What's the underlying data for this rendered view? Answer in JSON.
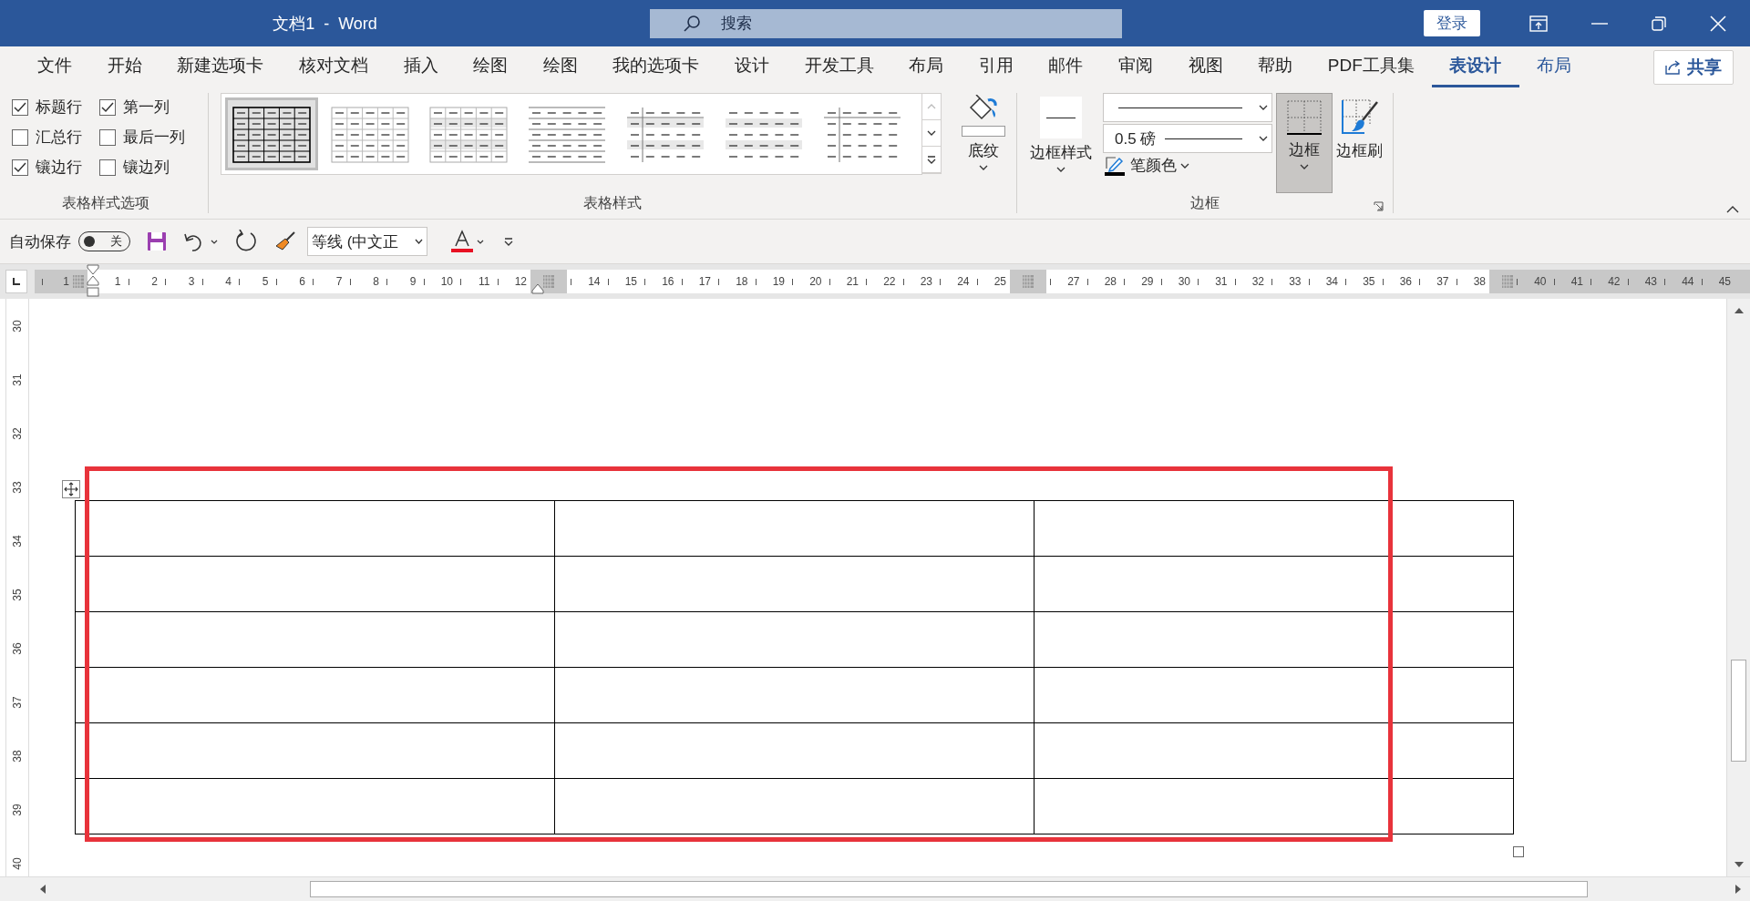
{
  "title_bar": {
    "title": "文档1  -  Word",
    "search": {
      "placeholder": "搜索"
    },
    "sign_in": "登录"
  },
  "menu_tabs": [
    {
      "label": "文件",
      "selected": false,
      "contextual": false
    },
    {
      "label": "开始",
      "selected": false,
      "contextual": false
    },
    {
      "label": "新建选项卡",
      "selected": false,
      "contextual": false
    },
    {
      "label": "核对文档",
      "selected": false,
      "contextual": false
    },
    {
      "label": "插入",
      "selected": false,
      "contextual": false
    },
    {
      "label": "绘图",
      "selected": false,
      "contextual": false
    },
    {
      "label": "绘图",
      "selected": false,
      "contextual": false
    },
    {
      "label": "我的选项卡",
      "selected": false,
      "contextual": false
    },
    {
      "label": "设计",
      "selected": false,
      "contextual": false
    },
    {
      "label": "开发工具",
      "selected": false,
      "contextual": false
    },
    {
      "label": "布局",
      "selected": false,
      "contextual": false
    },
    {
      "label": "引用",
      "selected": false,
      "contextual": false
    },
    {
      "label": "邮件",
      "selected": false,
      "contextual": false
    },
    {
      "label": "审阅",
      "selected": false,
      "contextual": false
    },
    {
      "label": "视图",
      "selected": false,
      "contextual": false
    },
    {
      "label": "帮助",
      "selected": false,
      "contextual": false
    },
    {
      "label": "PDF工具集",
      "selected": false,
      "contextual": false
    },
    {
      "label": "表设计",
      "selected": true,
      "contextual": true
    },
    {
      "label": "布局",
      "selected": false,
      "contextual": true
    }
  ],
  "share": "共享",
  "ribbon": {
    "table_style_options": {
      "options": [
        {
          "label": "标题行",
          "checked": true
        },
        {
          "label": "第一列",
          "checked": true
        },
        {
          "label": "汇总行",
          "checked": false
        },
        {
          "label": "最后一列",
          "checked": false
        },
        {
          "label": "镶边行",
          "checked": true
        },
        {
          "label": "镶边列",
          "checked": false
        }
      ],
      "caption": "表格样式选项"
    },
    "table_styles": {
      "styles": [
        {
          "kind": "grid-bold",
          "selected": true
        },
        {
          "kind": "grid-light",
          "selected": false
        },
        {
          "kind": "grid-shaded",
          "selected": false
        },
        {
          "kind": "lines",
          "selected": false
        },
        {
          "kind": "banded-split",
          "selected": false
        },
        {
          "kind": "banded",
          "selected": false
        },
        {
          "kind": "split",
          "selected": false
        }
      ],
      "caption": "表格样式"
    },
    "shading": {
      "label": "底纹"
    },
    "borders": {
      "border_styles": "边框样式",
      "pen_weight": "0.5 磅",
      "pen_color": "笔颜色",
      "borders_button": {
        "label": "边框",
        "selected": true
      },
      "border_painter": "边框刷",
      "caption": "边框"
    }
  },
  "quick_access": {
    "autosave": {
      "label": "自动保存",
      "on": false,
      "state_text": "关"
    },
    "font": "等线 (中文正"
  },
  "ruler": {
    "segments": [
      {
        "kind": "margin",
        "labels": [
          "1"
        ]
      },
      {
        "kind": "text",
        "labels": [
          "1",
          "2",
          "3",
          "4",
          "5",
          "6",
          "7",
          "8",
          "9",
          "10",
          "11",
          "12"
        ]
      },
      {
        "kind": "column-gap"
      },
      {
        "kind": "text",
        "labels": [
          "14",
          "15",
          "16",
          "17",
          "18",
          "19",
          "20",
          "21",
          "22",
          "23",
          "24",
          "25"
        ]
      },
      {
        "kind": "column-gap"
      },
      {
        "kind": "text",
        "labels": [
          "27",
          "28",
          "29",
          "30",
          "31",
          "32",
          "33",
          "34",
          "35",
          "36",
          "37",
          "38"
        ]
      },
      {
        "kind": "margin-end",
        "labels": [
          "40",
          "41",
          "42",
          "43",
          "44",
          "45"
        ]
      }
    ]
  },
  "vertical_ruler": {
    "labels": [
      "30",
      "31",
      "32",
      "33",
      "34",
      "35",
      "36",
      "37",
      "38",
      "39",
      "40"
    ]
  },
  "annotation": {
    "kind": "rectangle"
  }
}
